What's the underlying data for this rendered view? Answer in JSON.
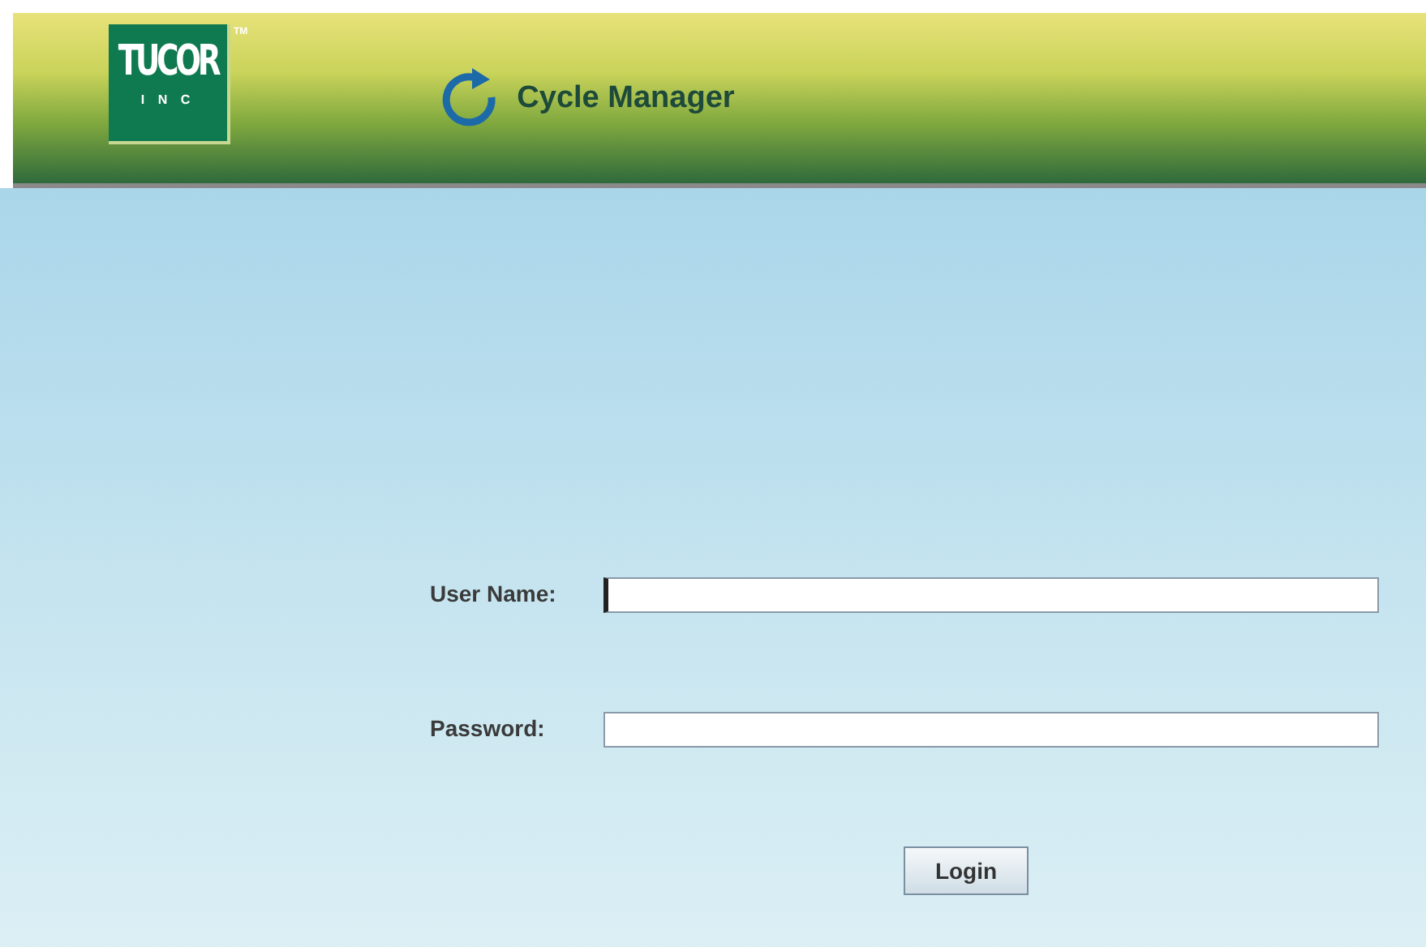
{
  "header": {
    "logo": {
      "name": "TUCOR",
      "subtitle": "I N C",
      "trademark": "TM"
    },
    "app_title": "Cycle Manager"
  },
  "login_form": {
    "fields": [
      {
        "label": "User Name:",
        "focused": true
      },
      {
        "label": "Password:",
        "focused": false
      }
    ],
    "button": "Login"
  }
}
